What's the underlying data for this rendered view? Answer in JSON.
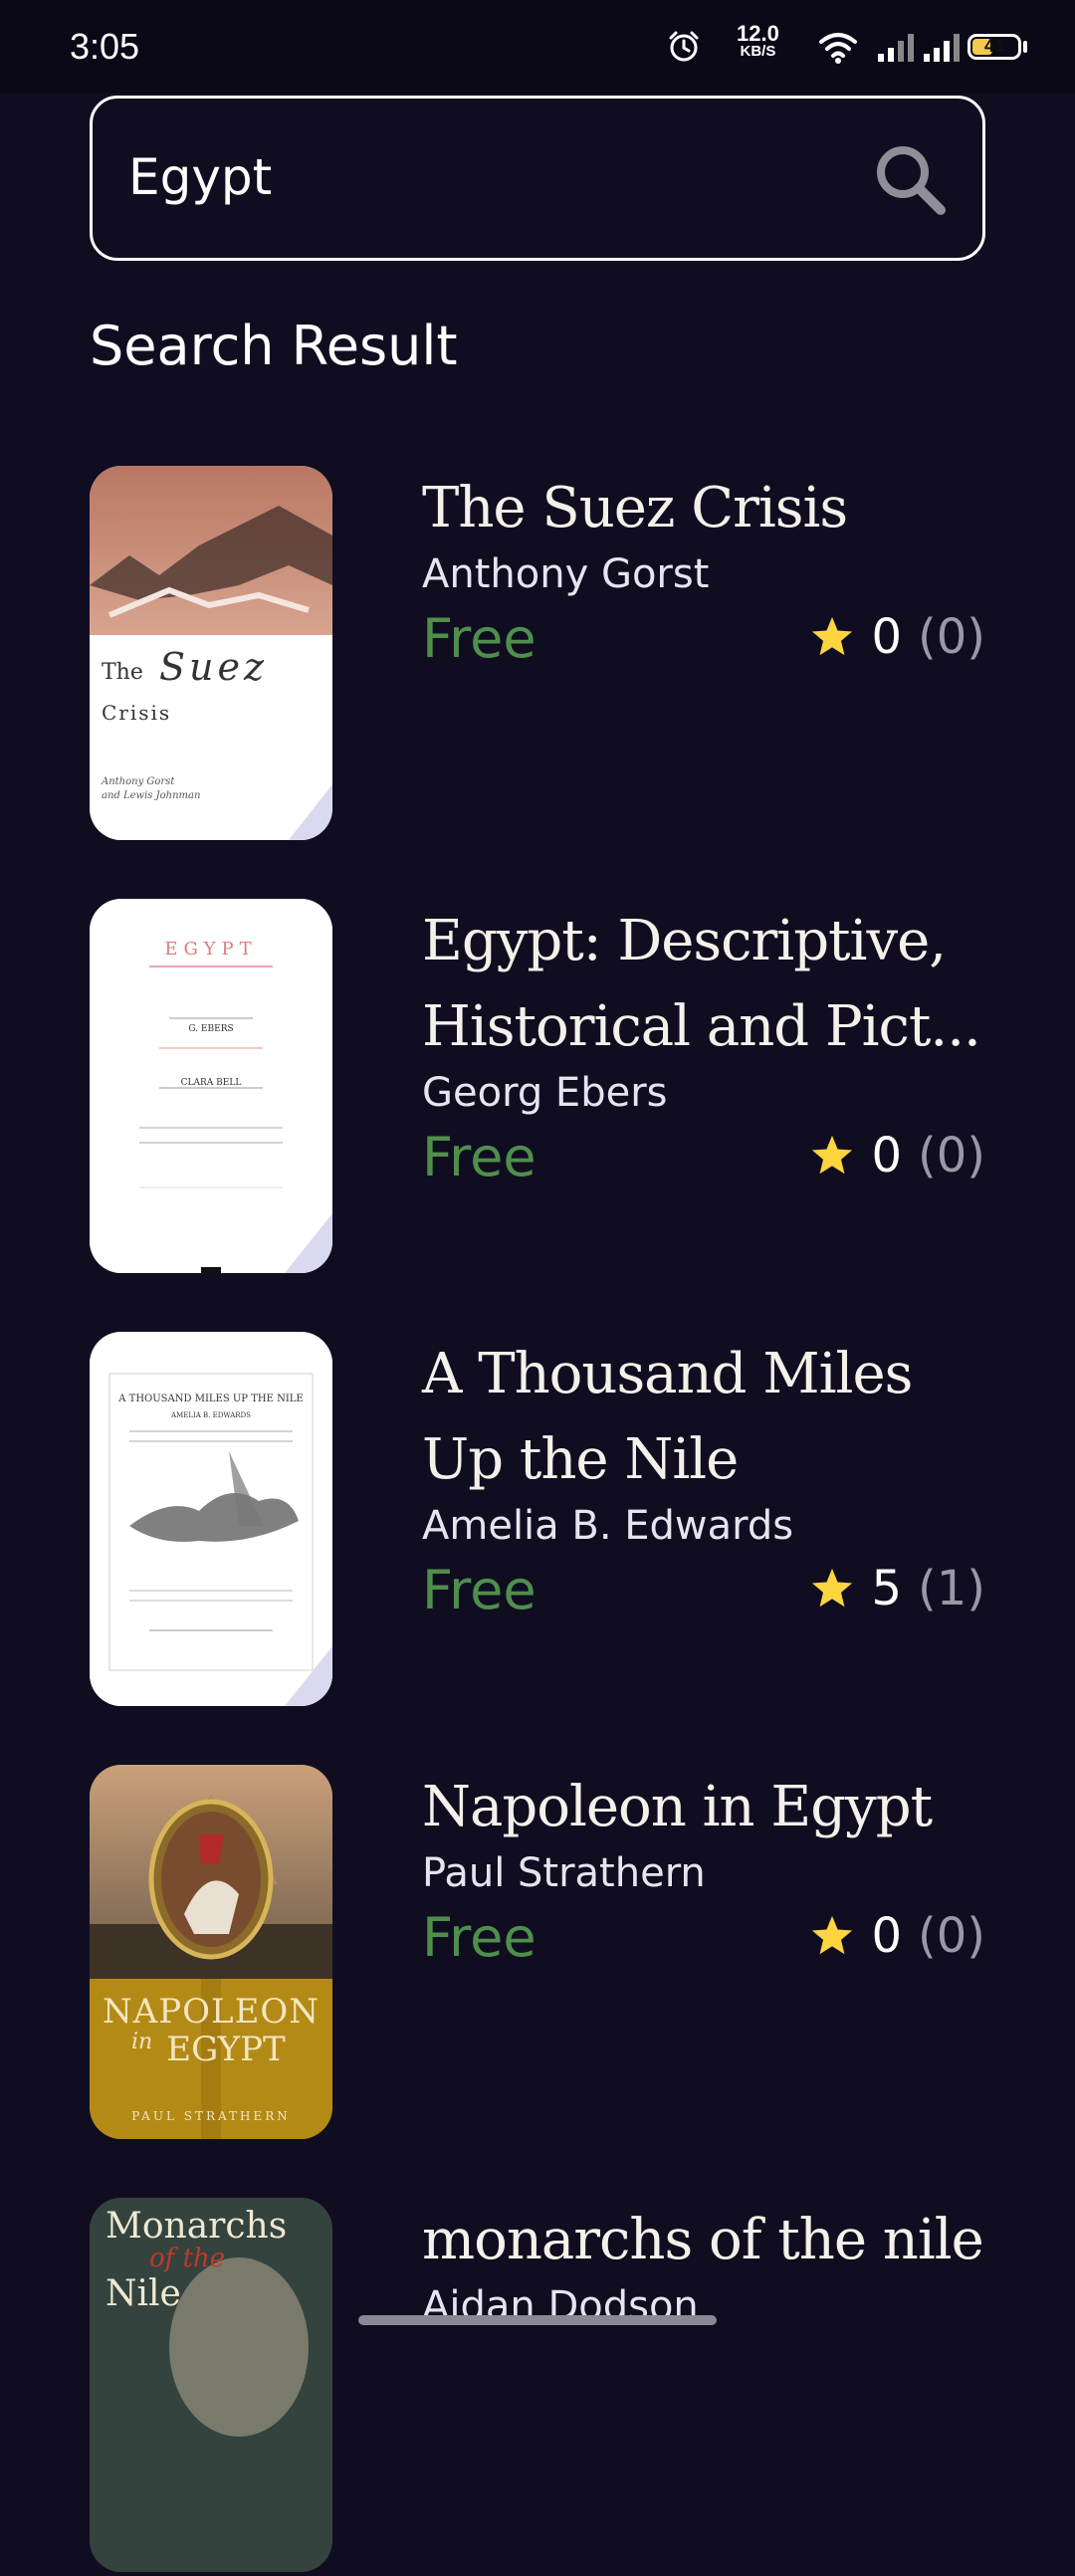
{
  "status_bar": {
    "time": "3:05",
    "network_speed_value": "12.0",
    "network_speed_unit": "KB/S",
    "battery": "41",
    "icons": [
      "alarm-icon",
      "wifi-icon",
      "signal-icon",
      "signal-icon",
      "battery-icon"
    ]
  },
  "search": {
    "value": "Egypt",
    "icon": "search-icon"
  },
  "section_title": "Search Result",
  "books": [
    {
      "title": "The Suez Crisis",
      "author": "Anthony Gorst",
      "price": "Free",
      "rating": "0",
      "count": "(0)",
      "cover_text": {
        "line1": "The",
        "line2": "Suez",
        "line3": "Crisis",
        "line4": "Anthony Gorst",
        "line5": "and Lewis Johnman"
      }
    },
    {
      "title": "Egypt: Descriptive, Historical and Pict...",
      "author": "Georg Ebers",
      "price": "Free",
      "rating": "0",
      "count": "(0)",
      "cover_text": {
        "line1": "EGYPT",
        "line2": "G. EBERS",
        "line3": "CLARA BELL"
      }
    },
    {
      "title": "A Thousand Miles Up the Nile",
      "author": "Amelia B. Edwards",
      "price": "Free",
      "rating": "5",
      "count": "(1)",
      "cover_text": {
        "line1": "A THOUSAND MILES UP THE NILE",
        "line2": "AMELIA B. EDWARDS"
      }
    },
    {
      "title": "Napoleon in Egypt",
      "author": "Paul Strathern",
      "price": "Free",
      "rating": "0",
      "count": "(0)",
      "cover_text": {
        "line1": "NAPOLEON",
        "line2": "in",
        "line3": "EGYPT",
        "line4": "PAUL STRATHERN"
      }
    },
    {
      "title": "monarchs of the nile",
      "author": "Aidan Dodson",
      "cover_text": {
        "line1": "Monarchs",
        "line2": "of the",
        "line3": "Nile"
      }
    }
  ],
  "colors": {
    "background": "#110d21",
    "price_green": "#4f8f4c",
    "star": "#fcd53f",
    "count_grey": "#9a98a6"
  }
}
